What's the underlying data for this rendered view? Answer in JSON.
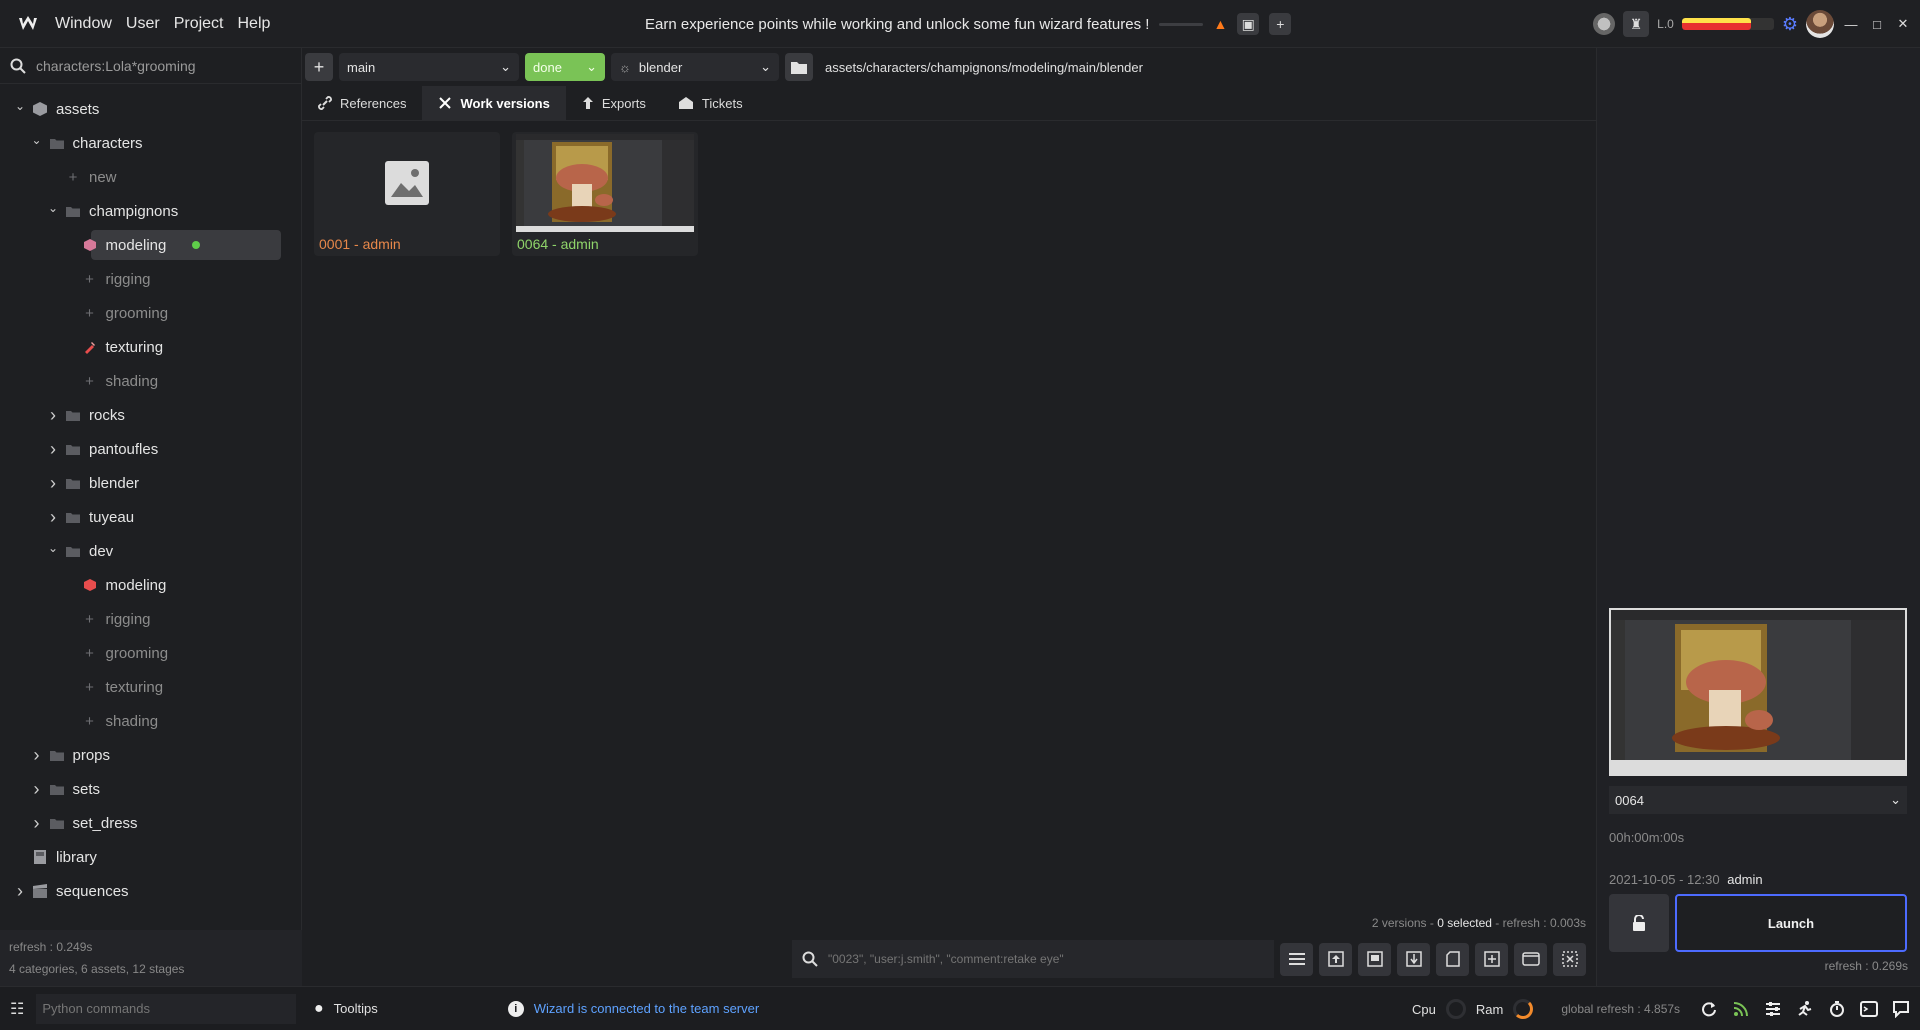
{
  "titlebar": {
    "menu": [
      "Window",
      "User",
      "Project",
      "Help"
    ],
    "xp_message": "Earn experience points while working and unlock some fun wizard features !",
    "level_label": "L.0",
    "progress": 0.75
  },
  "sidebar": {
    "search_value": "characters:Lola*grooming",
    "tree": [
      {
        "label": "assets",
        "depth": 0,
        "expander": "open",
        "icon": "cube-icon"
      },
      {
        "label": "characters",
        "depth": 1,
        "expander": "open",
        "icon": "folder-icon"
      },
      {
        "label": "new",
        "depth": 2,
        "expander": "none",
        "icon": "plus-icon",
        "muted": true
      },
      {
        "label": "champignons",
        "depth": 2,
        "expander": "open",
        "icon": "folder-icon"
      },
      {
        "label": "modeling",
        "depth": 3,
        "expander": "none",
        "icon": "stage-modeling-icon",
        "selected": true,
        "dot": true
      },
      {
        "label": "rigging",
        "depth": 3,
        "expander": "none",
        "icon": "plus-icon",
        "muted": true
      },
      {
        "label": "grooming",
        "depth": 3,
        "expander": "none",
        "icon": "plus-icon",
        "muted": true
      },
      {
        "label": "texturing",
        "depth": 3,
        "expander": "none",
        "icon": "brush-icon"
      },
      {
        "label": "shading",
        "depth": 3,
        "expander": "none",
        "icon": "plus-icon",
        "muted": true
      },
      {
        "label": "rocks",
        "depth": 2,
        "expander": "closed",
        "icon": "folder-icon"
      },
      {
        "label": "pantoufles",
        "depth": 2,
        "expander": "closed",
        "icon": "folder-icon"
      },
      {
        "label": "blender",
        "depth": 2,
        "expander": "closed",
        "icon": "folder-icon"
      },
      {
        "label": "tuyeau",
        "depth": 2,
        "expander": "closed",
        "icon": "folder-icon"
      },
      {
        "label": "dev",
        "depth": 2,
        "expander": "open",
        "icon": "folder-icon"
      },
      {
        "label": "modeling",
        "depth": 3,
        "expander": "none",
        "icon": "stage-red-icon"
      },
      {
        "label": "rigging",
        "depth": 3,
        "expander": "none",
        "icon": "plus-icon",
        "muted": true
      },
      {
        "label": "grooming",
        "depth": 3,
        "expander": "none",
        "icon": "plus-icon",
        "muted": true
      },
      {
        "label": "texturing",
        "depth": 3,
        "expander": "none",
        "icon": "plus-icon",
        "muted": true
      },
      {
        "label": "shading",
        "depth": 3,
        "expander": "none",
        "icon": "plus-icon",
        "muted": true
      },
      {
        "label": "props",
        "depth": 1,
        "expander": "closed",
        "icon": "folder-icon"
      },
      {
        "label": "sets",
        "depth": 1,
        "expander": "closed",
        "icon": "folder-icon"
      },
      {
        "label": "set_dress",
        "depth": 1,
        "expander": "closed",
        "icon": "folder-icon"
      },
      {
        "label": "library",
        "depth": 0,
        "expander": "none",
        "icon": "library-icon"
      },
      {
        "label": "sequences",
        "depth": 0,
        "expander": "closed",
        "icon": "clapper-icon"
      }
    ],
    "footer_refresh": "refresh : 0.249s",
    "footer_counts": "4 categories, 6 assets, 12 stages"
  },
  "toolbar": {
    "variant": "main",
    "state": "done",
    "software": "blender",
    "path": "assets/characters/champignons/modeling/main/blender"
  },
  "tabs": [
    {
      "label": "References",
      "icon": "link-icon"
    },
    {
      "label": "Work versions",
      "icon": "tools-icon",
      "active": true
    },
    {
      "label": "Exports",
      "icon": "arrow-up-icon"
    },
    {
      "label": "Tickets",
      "icon": "ticket-icon"
    }
  ],
  "versions": [
    {
      "label": "0001 - admin",
      "color": "#e8884a",
      "thumb": "placeholder"
    },
    {
      "label": "0064 - admin",
      "color": "#8fd46a",
      "thumb": "render"
    }
  ],
  "status": {
    "count": "2 versions",
    "selected": "0 selected",
    "refresh": "refresh : 0.003s"
  },
  "filter": {
    "placeholder": "\"0023\", \"user:j.smith\", \"comment:retake eye\""
  },
  "right_panel": {
    "version_selected": "0064",
    "duration": "00h:00m:00s",
    "date": "2021-10-05 - 12:30",
    "user": "admin",
    "launch_label": "Launch",
    "refresh": "refresh : 0.269s"
  },
  "footer": {
    "python_placeholder": "Python commands",
    "tooltips_label": "Tooltips",
    "wizard_message": "Wizard is connected to the team server",
    "cpu_label": "Cpu",
    "ram_label": "Ram",
    "global_refresh": "global refresh : 4.857s"
  },
  "colors": {
    "accent": "#4d6bff",
    "done_green": "#7ac356",
    "version_orange": "#e8884a",
    "version_green": "#8fd46a",
    "info_blue": "#5ea2ff"
  }
}
